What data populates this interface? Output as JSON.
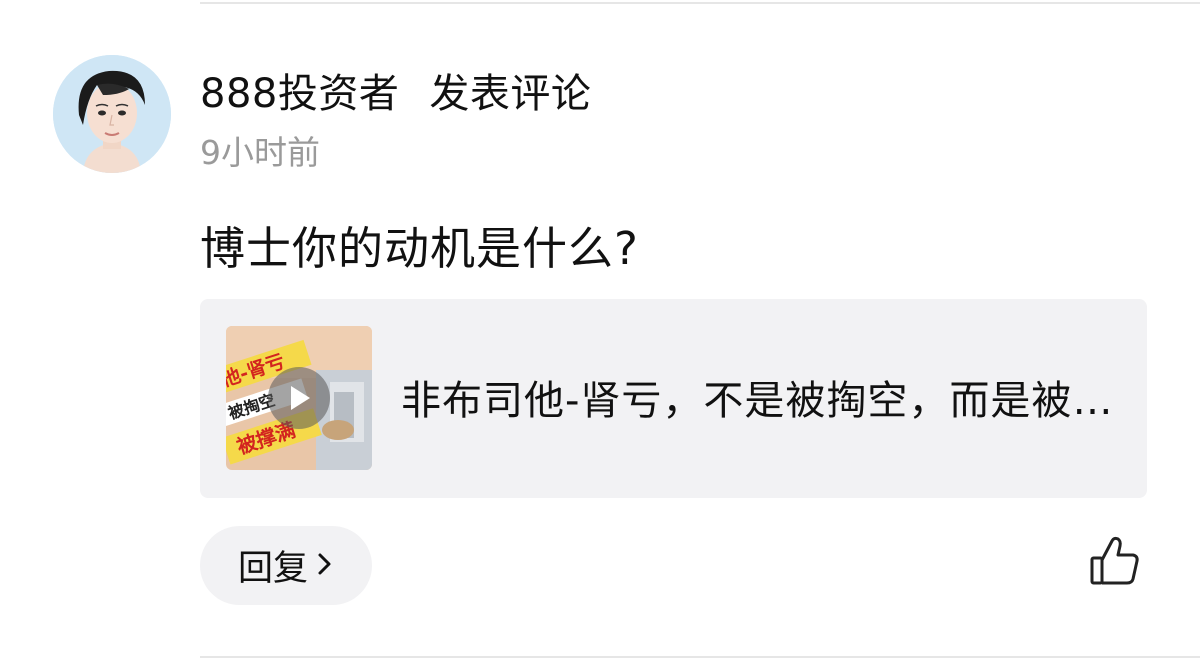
{
  "comment": {
    "author": "888投资者",
    "action": "发表评论",
    "time": "9小时前",
    "text": "博士你的动机是什么?"
  },
  "shared_card": {
    "title": "非布司他-肾亏，不是被掏空，而是被撑满",
    "thumbnail_texts": [
      "他-肾亏",
      "被掏空",
      "被撑满"
    ],
    "thumbnail_icon": "play-icon"
  },
  "actions": {
    "reply_label": "回复",
    "reply_icon": "chevron-right-icon",
    "like_icon": "thumbs-up-icon"
  },
  "colors": {
    "text_primary": "#111111",
    "text_secondary": "#9a9a9a",
    "card_background": "#f2f2f4",
    "divider": "#e6e6e6"
  }
}
